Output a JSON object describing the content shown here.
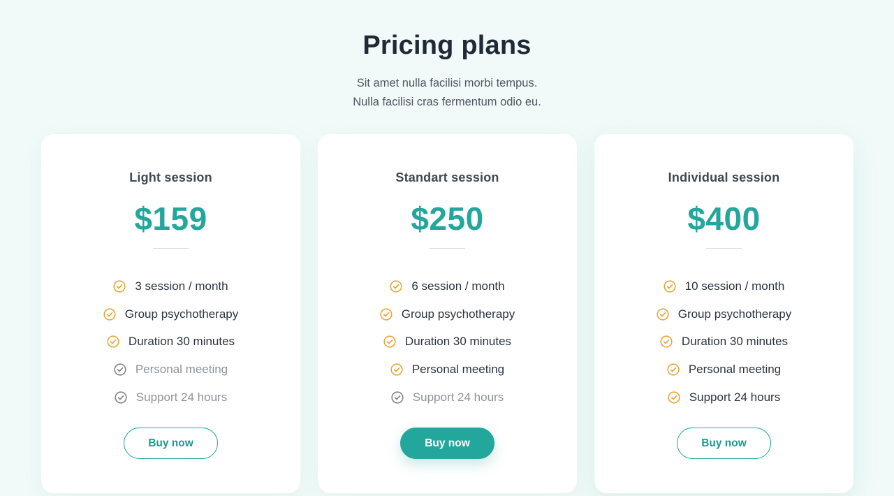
{
  "header": {
    "title": "Pricing plans",
    "subtitle_line1": "Sit amet nulla facilisi morbi tempus.",
    "subtitle_line2": "Nulla facilisi cras fermentum odio eu."
  },
  "colors": {
    "accent": "#23a79c",
    "check_included": "#e8a53c",
    "check_excluded": "#7d858c",
    "background": "#f1faf8"
  },
  "plans": [
    {
      "name": "Light session",
      "price": "$159",
      "button_label": "Buy now",
      "featured": false,
      "features": [
        {
          "label": "3 session / month",
          "included": true
        },
        {
          "label": "Group psychotherapy",
          "included": true
        },
        {
          "label": "Duration 30 minutes",
          "included": true
        },
        {
          "label": "Personal meeting",
          "included": false
        },
        {
          "label": "Support 24 hours",
          "included": false
        }
      ]
    },
    {
      "name": "Standart session",
      "price": "$250",
      "button_label": "Buy now",
      "featured": true,
      "features": [
        {
          "label": "6 session / month",
          "included": true
        },
        {
          "label": "Group psychotherapy",
          "included": true
        },
        {
          "label": "Duration 30 minutes",
          "included": true
        },
        {
          "label": "Personal meeting",
          "included": true
        },
        {
          "label": "Support 24 hours",
          "included": false
        }
      ]
    },
    {
      "name": "Individual session",
      "price": "$400",
      "button_label": "Buy now",
      "featured": false,
      "features": [
        {
          "label": "10 session / month",
          "included": true
        },
        {
          "label": "Group psychotherapy",
          "included": true
        },
        {
          "label": "Duration 30 minutes",
          "included": true
        },
        {
          "label": "Personal meeting",
          "included": true
        },
        {
          "label": "Support 24 hours",
          "included": true
        }
      ]
    }
  ]
}
